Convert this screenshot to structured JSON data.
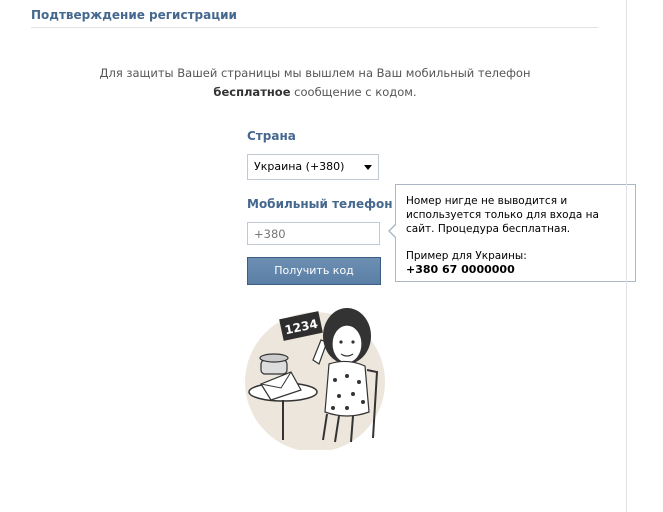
{
  "header": {
    "title": "Подтверждение регистрации"
  },
  "intro": {
    "line1": "Для защиты Вашей страницы мы вышлем на Ваш мобильный телефон",
    "bold": "бесплатное",
    "line2_rest": " сообщение с кодом."
  },
  "form": {
    "country_label": "Страна",
    "country_value": "Украина (+380)",
    "phone_label": "Мобильный телефон",
    "phone_value": "+380",
    "submit_label": "Получить код"
  },
  "tooltip": {
    "text": "Номер нигде не выводится и используется только для входа на сайт. Процедура бесплатная.",
    "example_label": "Пример для Украины:",
    "example_number": "+380 67 0000000"
  },
  "illustration": {
    "sign_text": "1234",
    "icon": "woman-with-code-sign-illustration"
  },
  "colors": {
    "accent": "#45688e",
    "button": "#5e82a8",
    "illustration_bg": "#ece6dd"
  }
}
